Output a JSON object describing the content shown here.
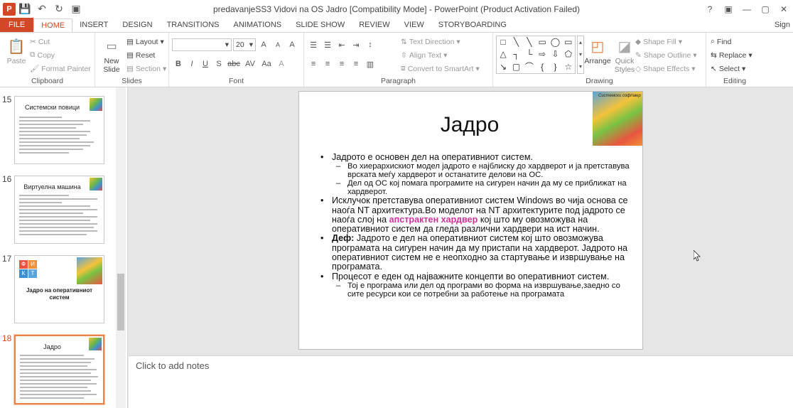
{
  "window": {
    "title": "predavanjeSS3 Vidovi na OS Jadro [Compatibility Mode] - PowerPoint (Product Activation Failed)",
    "help": "?",
    "minimize": "—",
    "restore": "▢",
    "close": "✕"
  },
  "qat": {
    "app_logo": "P",
    "save": "💾",
    "undo": "↶",
    "redo": "↻",
    "present": "▣"
  },
  "tabs": [
    {
      "label": "FILE"
    },
    {
      "label": "HOME"
    },
    {
      "label": "INSERT"
    },
    {
      "label": "DESIGN"
    },
    {
      "label": "TRANSITIONS"
    },
    {
      "label": "ANIMATIONS"
    },
    {
      "label": "SLIDE SHOW"
    },
    {
      "label": "REVIEW"
    },
    {
      "label": "VIEW"
    },
    {
      "label": "STORYBOARDING"
    }
  ],
  "signin": "Sign",
  "ribbon": {
    "clipboard": {
      "paste": "Paste",
      "cut": "Cut",
      "copy": "Copy",
      "format_painter": "Format Painter",
      "label": "Clipboard"
    },
    "slides": {
      "new_slide": "New",
      "new_slide2": "Slide",
      "layout": "Layout",
      "reset": "Reset",
      "section": "Section",
      "label": "Slides"
    },
    "font": {
      "font_name": "",
      "font_size": "20",
      "bold": "B",
      "italic": "I",
      "underline": "U",
      "strike": "S",
      "abc": "abc",
      "spacing": "AV",
      "case": "Aa",
      "grow": "A",
      "shrink": "A",
      "clear": "A",
      "color": "A",
      "label": "Font"
    },
    "paragraph": {
      "text_direction": "Text Direction",
      "align_text": "Align Text",
      "convert_smartart": "Convert to SmartArt",
      "label": "Paragraph"
    },
    "drawing": {
      "arrange": "Arrange",
      "quick_styles": "Quick",
      "quick_styles2": "Styles",
      "shape_fill": "Shape Fill",
      "shape_outline": "Shape Outline",
      "shape_effects": "Shape Effects",
      "label": "Drawing",
      "shapes": [
        "□",
        "╲",
        "╲",
        "▭",
        "◯",
        "▭",
        "△",
        "┐",
        "└",
        "⇨",
        "⇩",
        "⬠",
        "↘",
        "▢",
        "⌒",
        "{",
        "}",
        "☆"
      ]
    },
    "editing": {
      "find": "Find",
      "replace": "Replace",
      "select": "Select",
      "label": "Editing"
    }
  },
  "thumbnails": [
    {
      "num": "15",
      "title": "Системски повици"
    },
    {
      "num": "16",
      "title": "Виртуелна машина"
    },
    {
      "num": "17",
      "title": "Јадро на оперативниот систем",
      "logo": [
        "Ф",
        "И",
        "К",
        "Т"
      ]
    },
    {
      "num": "18",
      "title": "Јадро"
    }
  ],
  "slide": {
    "title": "Јадро",
    "image_caption": "Системски софтвер",
    "bullet1": "Јадрото е основен дел на оперативниот систем.",
    "bullet1_sub1": "Во хиерархискиот модел јадрото е најблиску до хардверот и ја претставува врската меѓу хардверот и останатите делови на ОС.",
    "bullet1_sub2": "Дел од ОС кој помага програмите на сигурен начин да му се приближат на хардверот.",
    "bullet2_a": "Исклучок претставува оперативниот систем Windows во чија основа се наоѓа NT архитектура.Во моделот на NT архитектурите под јадрото се наоѓа слој на ",
    "bullet2_hl": "апстрактен хардвер",
    "bullet2_b": " кој што му овозможува на оперативниот систем да гледа различни хардвери на ист начин.",
    "bullet3_bold": "Деф:",
    "bullet3": " Јадрото е дел на оперативниот систем кој што овозможува програмата на сигурен начин да му пристапи  на хардверот. Јадрото на оперативниот систем не е неопходно за стартување и извршување на програмата.",
    "bullet4": "Процесот е еден од најважните концепти во оперативниот систем.",
    "bullet4_sub1": "Тој е програма или дел од програми во форма на извршување,заедно со сите ресурси кои се потребни за работење на програмата"
  },
  "notes": {
    "placeholder": "Click to add notes"
  },
  "colors": {
    "accent": "#d24726",
    "highlight": "#cc3399",
    "selected_thumb": "#e8844a"
  }
}
